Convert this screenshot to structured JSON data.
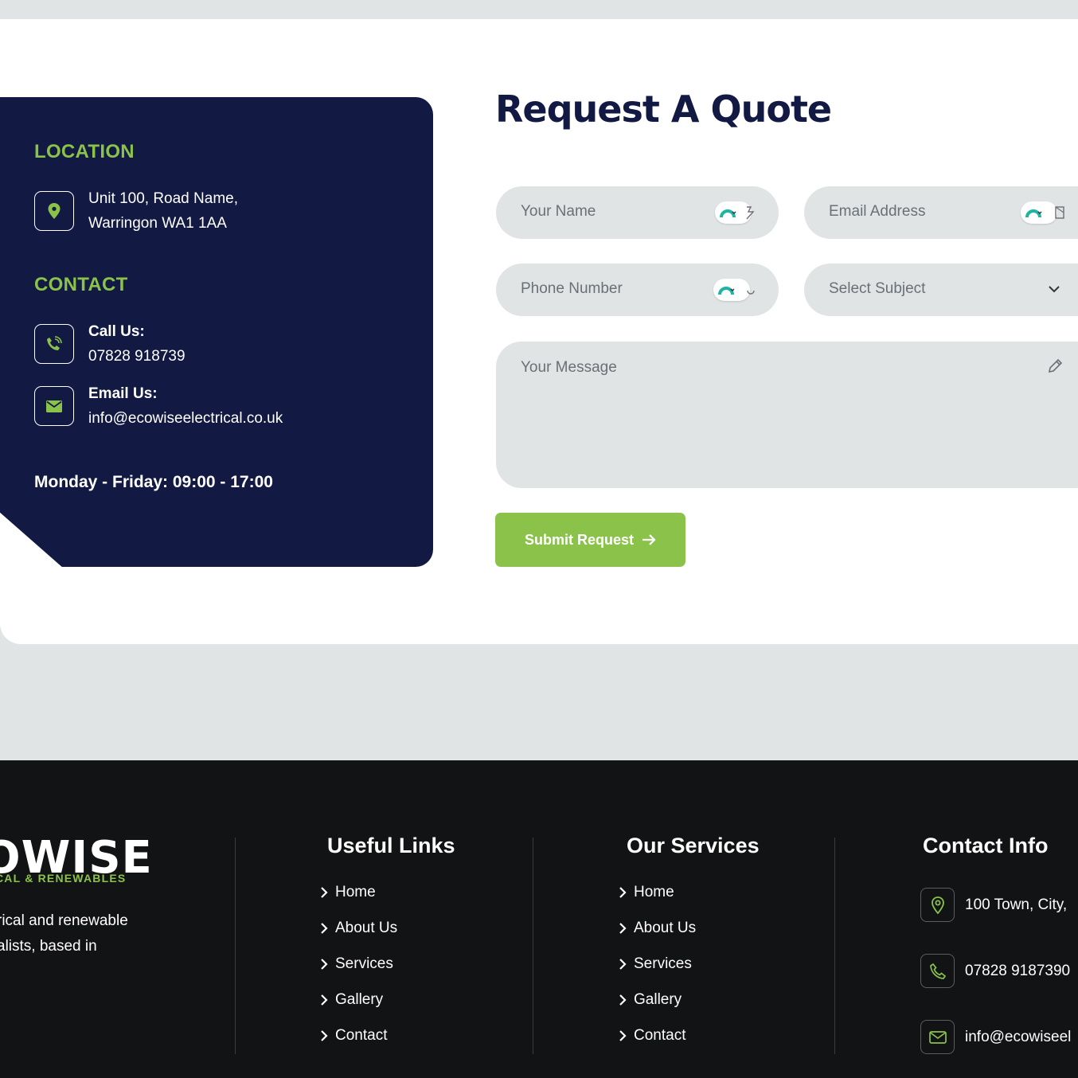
{
  "info": {
    "location_heading": "LOCATION",
    "address_line1": "Unit 100, Road Name,",
    "address_line2": "Warringon WA1 1AA",
    "contact_heading": "CONTACT",
    "call_label": "Call Us:",
    "call_value": "07828 918739",
    "email_label": "Email Us:",
    "email_value": "info@ecowiseelectrical.co.uk",
    "hours": "Monday - Friday: 09:00 - 17:00"
  },
  "form": {
    "title": "Request A Quote",
    "name_placeholder": "Your Name",
    "email_placeholder": "Email Address",
    "phone_placeholder": "Phone Number",
    "subject_selected": "Select Subject",
    "message_placeholder": "Your Message",
    "submit_label": "Submit Request"
  },
  "footer": {
    "logo_word": "OWISE",
    "logo_sub": "CAL & RENEWABLES",
    "about_line1": "rical and renewable",
    "about_line2": "alists, based in",
    "useful_links": {
      "title": "Useful Links",
      "items": [
        "Home",
        "About Us",
        "Services",
        "Gallery",
        "Contact"
      ]
    },
    "our_services": {
      "title": "Our Services",
      "items": [
        "Home",
        "About Us",
        "Services",
        "Gallery",
        "Contact"
      ]
    },
    "contact_info": {
      "title": "Contact Info",
      "address": "100 Town, City,",
      "phone": "07828 9187390",
      "email": "info@ecowiseel"
    }
  },
  "colors": {
    "navy": "#121942",
    "green": "#8bc34a",
    "footer_bg": "#121314",
    "field_bg": "#e1e4e5"
  },
  "icons": [
    "map-pin-icon",
    "phone-icon",
    "envelope-icon",
    "chevron-down-icon",
    "pencil-icon",
    "arrow-right-icon",
    "chevron-right-icon",
    "password-manager-icon"
  ]
}
